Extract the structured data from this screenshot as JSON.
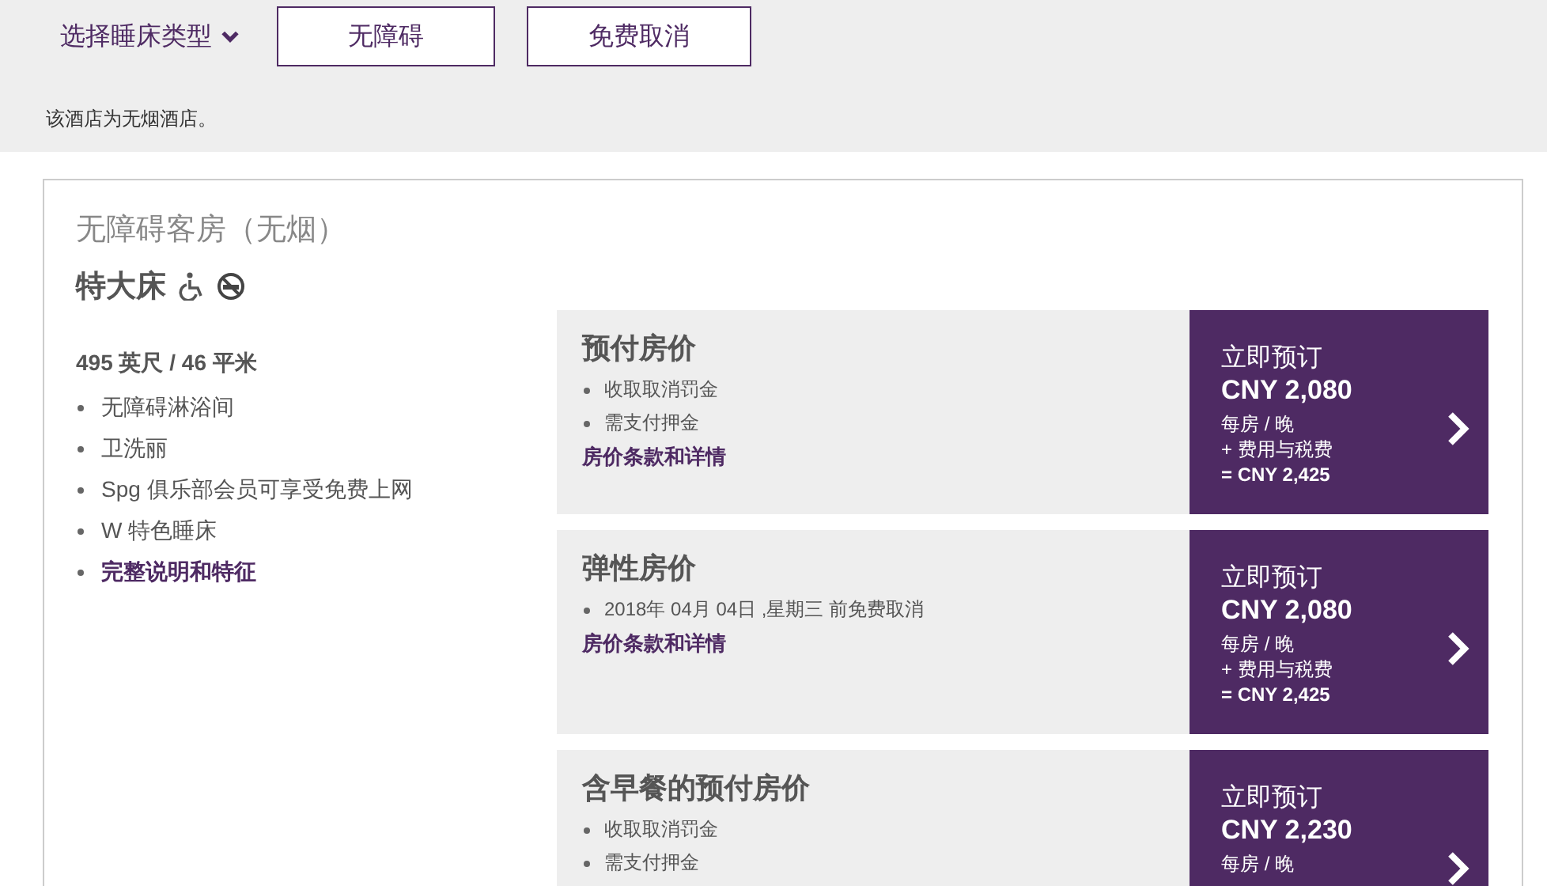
{
  "filters": {
    "bed_type": "选择睡床类型",
    "buttons": [
      "无障碍",
      "免费取消"
    ],
    "note": "该酒店为无烟酒店。"
  },
  "room": {
    "title": "无障碍客房（无烟）",
    "bed": "特大床",
    "size": "495 英尺 / 46 平米",
    "features": [
      "无障碍淋浴间",
      "卫洗丽",
      "Spg 俱乐部会员可享受免费上网",
      "W 特色睡床"
    ],
    "details_link": "完整说明和特征"
  },
  "rates": [
    {
      "name": "预付房价",
      "bullets": [
        "收取取消罚金",
        "需支付押金"
      ],
      "link": "房价条款和详情",
      "book": "立即预订",
      "price": "CNY 2,080",
      "per": "每房 / 晚",
      "fees": "+ 费用与税费",
      "total": "= CNY 2,425"
    },
    {
      "name": "弹性房价",
      "bullets": [
        "2018年 04月 04日 ,星期三 前免费取消"
      ],
      "link": "房价条款和详情",
      "book": "立即预订",
      "price": "CNY 2,080",
      "per": "每房 / 晚",
      "fees": "+ 费用与税费",
      "total": "= CNY 2,425"
    },
    {
      "name": "含早餐的预付房价",
      "bullets": [
        "收取取消罚金",
        "需支付押金"
      ],
      "book": "立即预订",
      "price": "CNY 2,230",
      "per": "每房 / 晚"
    }
  ]
}
